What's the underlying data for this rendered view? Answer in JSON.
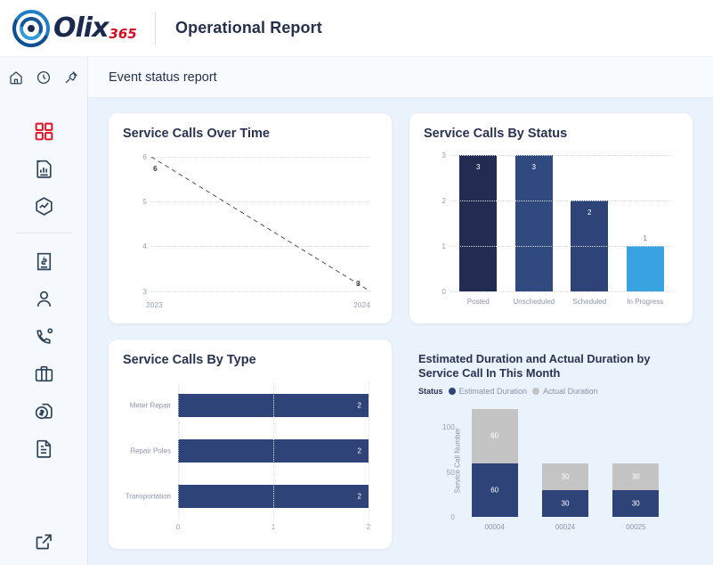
{
  "brand": {
    "name": "Olix",
    "suffix": "365"
  },
  "header": {
    "title": "Operational Report"
  },
  "subheader": {
    "title": "Event status report"
  },
  "sidebar": {
    "top_icons": [
      {
        "name": "home-icon"
      },
      {
        "name": "recent-icon"
      },
      {
        "name": "pin-icon"
      }
    ],
    "items": [
      {
        "name": "dashboard-icon",
        "active": true
      },
      {
        "name": "report-icon",
        "active": false
      },
      {
        "name": "analytics-icon",
        "active": false
      },
      {
        "name": "invoice-icon",
        "active": false
      },
      {
        "name": "contact-icon",
        "active": false
      },
      {
        "name": "call-icon",
        "active": false
      },
      {
        "name": "briefcase-icon",
        "active": false
      },
      {
        "name": "billing-icon",
        "active": false
      },
      {
        "name": "document-icon",
        "active": false
      }
    ],
    "footer_icon": {
      "name": "external-link-icon"
    }
  },
  "colors": {
    "accent_red": "#e01b2e",
    "navy_dark": "#222b52",
    "navy_mid": "#304a7f",
    "navy": "#2e4478",
    "light_blue": "#38a3e0",
    "gray": "#c4c4c4",
    "page_bg": "#eaf2fb"
  },
  "chart_data": [
    {
      "type": "line",
      "title": "Service Calls Over Time",
      "categories": [
        "2023",
        "2024"
      ],
      "values": [
        6,
        3
      ],
      "point_labels": [
        "6",
        "3"
      ],
      "yticks": [
        6,
        5,
        4,
        3
      ],
      "ylim": [
        3,
        6
      ],
      "xlabel": "",
      "ylabel": "",
      "grid": true,
      "line_style": "dashed",
      "line_color": "#3a3f52"
    },
    {
      "type": "bar",
      "title": "Service Calls By Status",
      "categories": [
        "Posted",
        "Unscheduled",
        "Scheduled",
        "In Progress"
      ],
      "values": [
        3,
        3,
        2,
        1
      ],
      "bar_colors": [
        "#222b52",
        "#304a7f",
        "#2e4478",
        "#38a3e0"
      ],
      "yticks": [
        3,
        2,
        1,
        0
      ],
      "ylim": [
        0,
        3
      ],
      "xlabel": "",
      "ylabel": "",
      "grid": true
    },
    {
      "type": "bar",
      "orientation": "horizontal",
      "title": "Service Calls By Type",
      "categories": [
        "Meter Repair",
        "Repair Poles",
        "Transportation"
      ],
      "values": [
        2,
        2,
        2
      ],
      "xticks": [
        0,
        1,
        2
      ],
      "xlim": [
        0,
        2
      ],
      "bar_color": "#2e4478",
      "xlabel": "",
      "ylabel": "",
      "grid": true
    },
    {
      "type": "bar",
      "stacked": true,
      "title": "Estimated Duration and Actual Duration by Service Call In This Month",
      "legend_label": "Status",
      "categories": [
        "00004",
        "00024",
        "00025"
      ],
      "series": [
        {
          "name": "Estimated Duration",
          "color": "#2e4478",
          "values": [
            60,
            30,
            30
          ]
        },
        {
          "name": "Actual Duration",
          "color": "#c4c4c4",
          "values": [
            60,
            30,
            30
          ]
        }
      ],
      "yticks": [
        100,
        50,
        0
      ],
      "ylim": [
        0,
        125
      ],
      "xlabel": "",
      "ylabel": "Service Call Number",
      "legend_position": "top",
      "grid": false
    }
  ]
}
